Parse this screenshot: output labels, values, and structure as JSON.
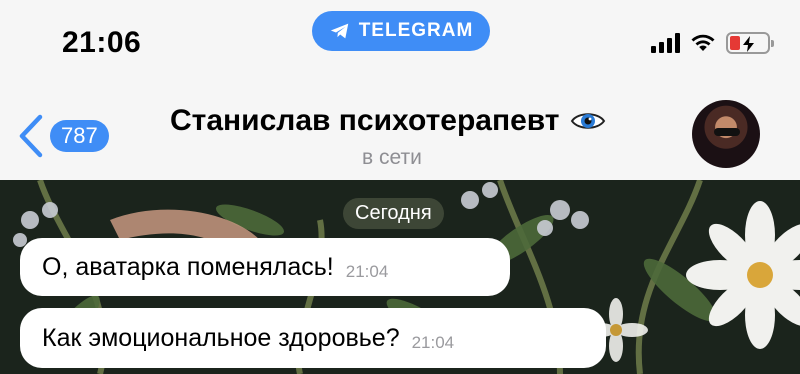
{
  "status_bar": {
    "time": "21:06",
    "app_pill_label": "TELEGRAM",
    "icons": [
      "cellular-signal-icon",
      "wifi-icon",
      "battery-low-charging-icon"
    ]
  },
  "header": {
    "back_badge": "787",
    "contact_name": "Станислав психотерапевт",
    "name_emoji_icon": "eye-emoji-icon",
    "status": "в сети"
  },
  "chat": {
    "date_separator": "Сегодня",
    "messages": [
      {
        "text": "О, аватарка поменялась!",
        "time": "21:04"
      },
      {
        "text": "Как эмоциональное здоровье?",
        "time": "21:04"
      }
    ]
  },
  "colors": {
    "accent": "#3f8df6",
    "battery_low": "#e53935",
    "wallpaper": "#1b241c"
  }
}
